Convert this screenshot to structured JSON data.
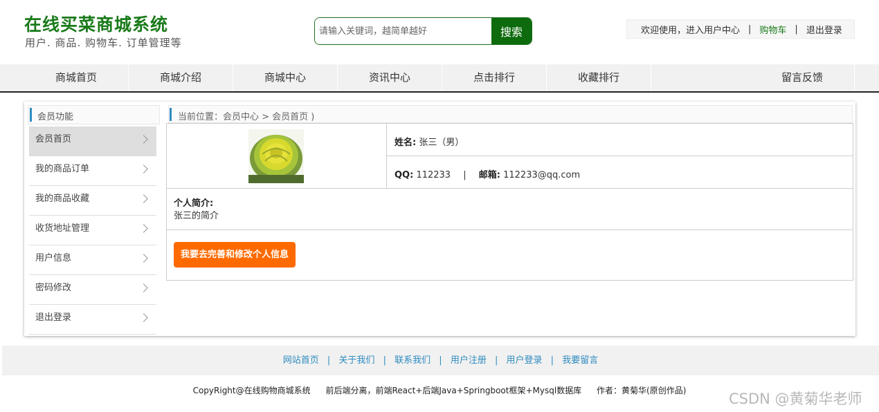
{
  "header": {
    "title": "在线买菜商城系统",
    "subtitle": "用户. 商品. 购物车. 订单管理等",
    "search_placeholder": "请输入关键词，越简单越好",
    "search_button": "搜索",
    "welcome": "欢迎使用，进入用户中心",
    "cart": "购物车",
    "logout": "退出登录"
  },
  "nav": [
    "商城首页",
    "商城介绍",
    "商城中心",
    "资讯中心",
    "点击排行",
    "收藏排行",
    "留言反馈"
  ],
  "sidebar": {
    "title": "会员功能",
    "items": [
      "会员首页",
      "我的商品订单",
      "我的商品收藏",
      "收货地址管理",
      "用户信息",
      "密码修改",
      "退出登录"
    ]
  },
  "breadcrumb": "当前位置：会员中心 > 会员首页 )",
  "profile": {
    "name_label": "姓名:",
    "name_value": "张三（男）",
    "qq_label": "QQ:",
    "qq_value": "112233",
    "divider": "|",
    "email_label": "邮箱:",
    "email_value": "112233@qq.com",
    "intro_label": "个人简介:",
    "intro_value": "张三的简介",
    "edit_button": "我要去完善和修改个人信息"
  },
  "footer": {
    "links": [
      "网站首页",
      "关于我们",
      "联系我们",
      "用户注册",
      "用户登录",
      "我要留言"
    ],
    "copyright": "CopyRight@在线购物商城系统",
    "tech": "前后端分离，前端React+后端Java+Springboot框架+Mysql数据库",
    "author": "作者：黄菊华(原创作品)"
  },
  "watermark": "CSDN @黄菊华老师"
}
